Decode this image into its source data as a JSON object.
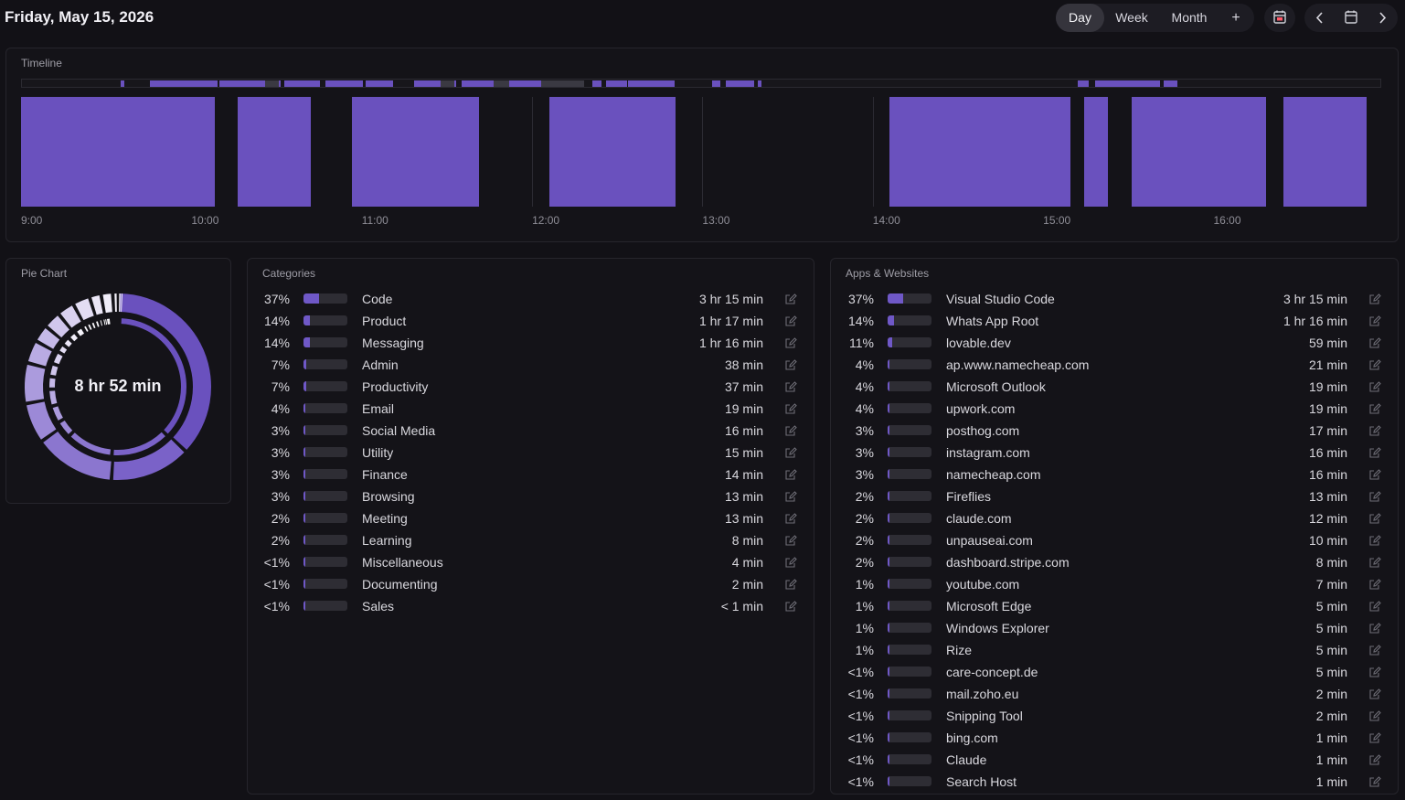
{
  "header": {
    "date": "Friday, May 15, 2026",
    "views": [
      "Day",
      "Week",
      "Month"
    ],
    "active_view": "Day",
    "add_label": "+"
  },
  "colors": {
    "accent": "#6a51be",
    "background": "#121116",
    "panel": "#141318"
  },
  "timeline": {
    "title": "Timeline",
    "ticks": [
      "9:00",
      "10:00",
      "11:00",
      "12:00",
      "13:00",
      "14:00",
      "15:00",
      "16:00"
    ],
    "start_hour": 9.0,
    "end_hour": 16.99,
    "blocks": [
      [
        9.0,
        10.14
      ],
      [
        10.27,
        10.7
      ],
      [
        10.94,
        11.69
      ],
      [
        12.1,
        12.84
      ],
      [
        14.1,
        15.16
      ],
      [
        15.24,
        15.38
      ],
      [
        15.52,
        16.31
      ],
      [
        16.41,
        16.9
      ]
    ],
    "strip_segments": [
      [
        9.0,
        16.99,
        "#17161b"
      ]
    ]
  },
  "pie": {
    "title": "Pie Chart",
    "total": "8 hr 52 min"
  },
  "categories": {
    "title": "Categories",
    "items": [
      {
        "pct": "37%",
        "frac": 0.37,
        "name": "Code",
        "dur": "3 hr 15 min"
      },
      {
        "pct": "14%",
        "frac": 0.14,
        "name": "Product",
        "dur": "1 hr 17 min"
      },
      {
        "pct": "14%",
        "frac": 0.14,
        "name": "Messaging",
        "dur": "1 hr 16 min"
      },
      {
        "pct": "7%",
        "frac": 0.07,
        "name": "Admin",
        "dur": "38 min"
      },
      {
        "pct": "7%",
        "frac": 0.07,
        "name": "Productivity",
        "dur": "37 min"
      },
      {
        "pct": "4%",
        "frac": 0.04,
        "name": "Email",
        "dur": "19 min"
      },
      {
        "pct": "3%",
        "frac": 0.03,
        "name": "Social Media",
        "dur": "16 min"
      },
      {
        "pct": "3%",
        "frac": 0.03,
        "name": "Utility",
        "dur": "15 min"
      },
      {
        "pct": "3%",
        "frac": 0.03,
        "name": "Finance",
        "dur": "14 min"
      },
      {
        "pct": "3%",
        "frac": 0.03,
        "name": "Browsing",
        "dur": "13 min"
      },
      {
        "pct": "2%",
        "frac": 0.02,
        "name": "Meeting",
        "dur": "13 min"
      },
      {
        "pct": "2%",
        "frac": 0.02,
        "name": "Learning",
        "dur": "8 min"
      },
      {
        "pct": "<1%",
        "frac": 0.008,
        "name": "Miscellaneous",
        "dur": "4 min"
      },
      {
        "pct": "<1%",
        "frac": 0.004,
        "name": "Documenting",
        "dur": "2 min"
      },
      {
        "pct": "<1%",
        "frac": 0.002,
        "name": "Sales",
        "dur": "< 1 min"
      }
    ]
  },
  "apps": {
    "title": "Apps & Websites",
    "items": [
      {
        "pct": "37%",
        "frac": 0.37,
        "name": "Visual Studio Code",
        "dur": "3 hr 15 min"
      },
      {
        "pct": "14%",
        "frac": 0.14,
        "name": "Whats App Root",
        "dur": "1 hr 16 min"
      },
      {
        "pct": "11%",
        "frac": 0.11,
        "name": "lovable.dev",
        "dur": "59 min"
      },
      {
        "pct": "4%",
        "frac": 0.04,
        "name": "ap.www.namecheap.com",
        "dur": "21 min"
      },
      {
        "pct": "4%",
        "frac": 0.04,
        "name": "Microsoft Outlook",
        "dur": "19 min"
      },
      {
        "pct": "4%",
        "frac": 0.04,
        "name": "upwork.com",
        "dur": "19 min"
      },
      {
        "pct": "3%",
        "frac": 0.03,
        "name": "posthog.com",
        "dur": "17 min"
      },
      {
        "pct": "3%",
        "frac": 0.03,
        "name": "instagram.com",
        "dur": "16 min"
      },
      {
        "pct": "3%",
        "frac": 0.03,
        "name": "namecheap.com",
        "dur": "16 min"
      },
      {
        "pct": "2%",
        "frac": 0.02,
        "name": "Fireflies",
        "dur": "13 min"
      },
      {
        "pct": "2%",
        "frac": 0.02,
        "name": "claude.com",
        "dur": "12 min"
      },
      {
        "pct": "2%",
        "frac": 0.02,
        "name": "unpauseai.com",
        "dur": "10 min"
      },
      {
        "pct": "2%",
        "frac": 0.02,
        "name": "dashboard.stripe.com",
        "dur": "8 min"
      },
      {
        "pct": "1%",
        "frac": 0.01,
        "name": "youtube.com",
        "dur": "7 min"
      },
      {
        "pct": "1%",
        "frac": 0.01,
        "name": "Microsoft Edge",
        "dur": "5 min"
      },
      {
        "pct": "1%",
        "frac": 0.01,
        "name": "Windows Explorer",
        "dur": "5 min"
      },
      {
        "pct": "1%",
        "frac": 0.01,
        "name": "Rize",
        "dur": "5 min"
      },
      {
        "pct": "<1%",
        "frac": 0.008,
        "name": "care-concept.de",
        "dur": "5 min"
      },
      {
        "pct": "<1%",
        "frac": 0.004,
        "name": "mail.zoho.eu",
        "dur": "2 min"
      },
      {
        "pct": "<1%",
        "frac": 0.004,
        "name": "Snipping Tool",
        "dur": "2 min"
      },
      {
        "pct": "<1%",
        "frac": 0.002,
        "name": "bing.com",
        "dur": "1 min"
      },
      {
        "pct": "<1%",
        "frac": 0.002,
        "name": "Claude",
        "dur": "1 min"
      },
      {
        "pct": "<1%",
        "frac": 0.002,
        "name": "Search Host",
        "dur": "1 min"
      }
    ]
  },
  "icons": {
    "edit": "edit-icon",
    "today": "calendar-check-icon",
    "prev": "chevron-left-icon",
    "calendar": "calendar-icon",
    "next": "chevron-right-icon"
  }
}
